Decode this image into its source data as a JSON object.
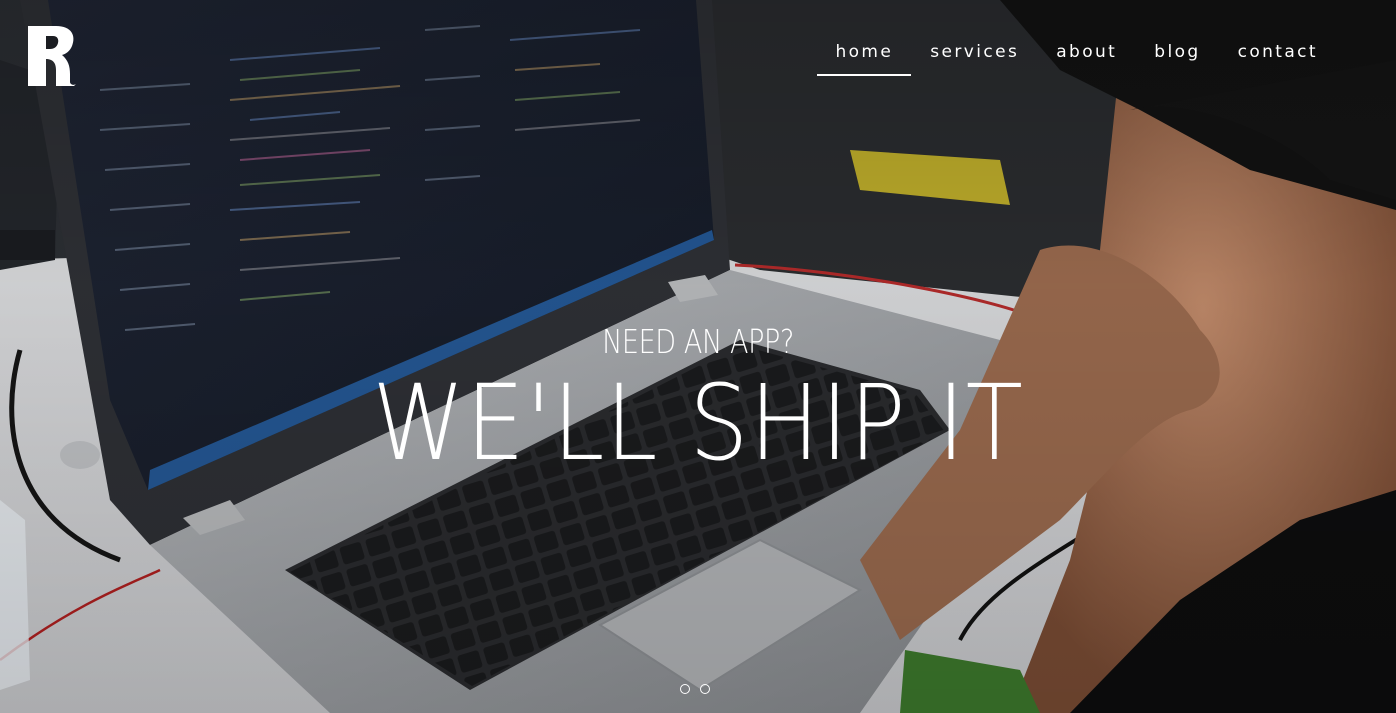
{
  "nav": {
    "items": [
      {
        "label": "home",
        "active": true
      },
      {
        "label": "services",
        "active": false
      },
      {
        "label": "about",
        "active": false
      },
      {
        "label": "blog",
        "active": false
      },
      {
        "label": "contact",
        "active": false
      }
    ]
  },
  "hero": {
    "subheading": "NEED AN APP?",
    "heading": "WE'LL SHIP IT",
    "slide_count": 2,
    "active_slide": 1
  },
  "colors": {
    "nav_text": "#ffffff",
    "heading_text": "#ffffff",
    "laptop_silver": "#9c9fa3",
    "screen_dark": "#1c2433"
  },
  "icons": [
    "brand-logo-icon"
  ]
}
